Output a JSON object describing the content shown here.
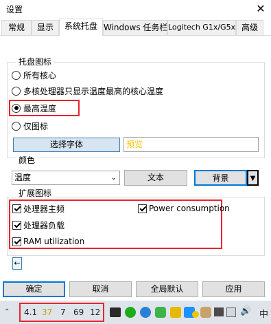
{
  "window": {
    "title": "设置",
    "close_glyph": "✕"
  },
  "tabs": [
    {
      "label": "常规"
    },
    {
      "label": "显示"
    },
    {
      "label": "系统托盘",
      "active": true
    },
    {
      "label": "Windows 任务栏"
    },
    {
      "label": "Logitech G1x/G5xx"
    },
    {
      "label": "高级"
    }
  ],
  "tray_icon_group": {
    "label": "托盘图标",
    "options": [
      {
        "label": "所有核心",
        "selected": false
      },
      {
        "label": "多核处理器只显示温度最高的核心温度",
        "selected": false
      },
      {
        "label": "最高温度",
        "selected": true
      },
      {
        "label": "仅图标",
        "selected": false
      }
    ],
    "font_button": "选择字体",
    "preview_text": "预览"
  },
  "color_group": {
    "label": "颜色",
    "select_value": "温度",
    "text_button": "文本",
    "bg_button": "背景"
  },
  "extended_group": {
    "label": "扩展图标",
    "checks": [
      {
        "label": "处理器主频",
        "checked": true
      },
      {
        "label": "Power consumption",
        "checked": true
      },
      {
        "label": "处理器负载",
        "checked": true
      },
      {
        "label": "RAM utilization",
        "checked": true
      }
    ]
  },
  "footer": {
    "ok": "确定",
    "cancel": "取消",
    "defaults": "全局默认",
    "apply": "应用"
  },
  "taskbar": {
    "readouts": [
      {
        "value": "4.1",
        "color": "#222222"
      },
      {
        "value": "37",
        "color": "#c8a000"
      },
      {
        "value": "7",
        "color": "#222222"
      },
      {
        "value": "69",
        "color": "#222222"
      },
      {
        "value": "12",
        "color": "#222222"
      }
    ],
    "ime_label": "中"
  },
  "colors": {
    "highlight_red": "#e8252e",
    "preview_yellow": "#f5c400"
  }
}
